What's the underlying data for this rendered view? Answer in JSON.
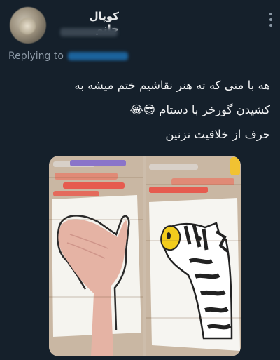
{
  "tweet": {
    "author_name": "کوپال خانم",
    "replying_label": "Replying to",
    "text_lines": [
      "هه با منی که ته هنر نقاشیم ختم میشه به",
      "کشیدن گورخر با دستام 😎😂",
      "حرف از خلاقیت نزنین"
    ]
  },
  "icons": {
    "more": "more-options-icon"
  }
}
